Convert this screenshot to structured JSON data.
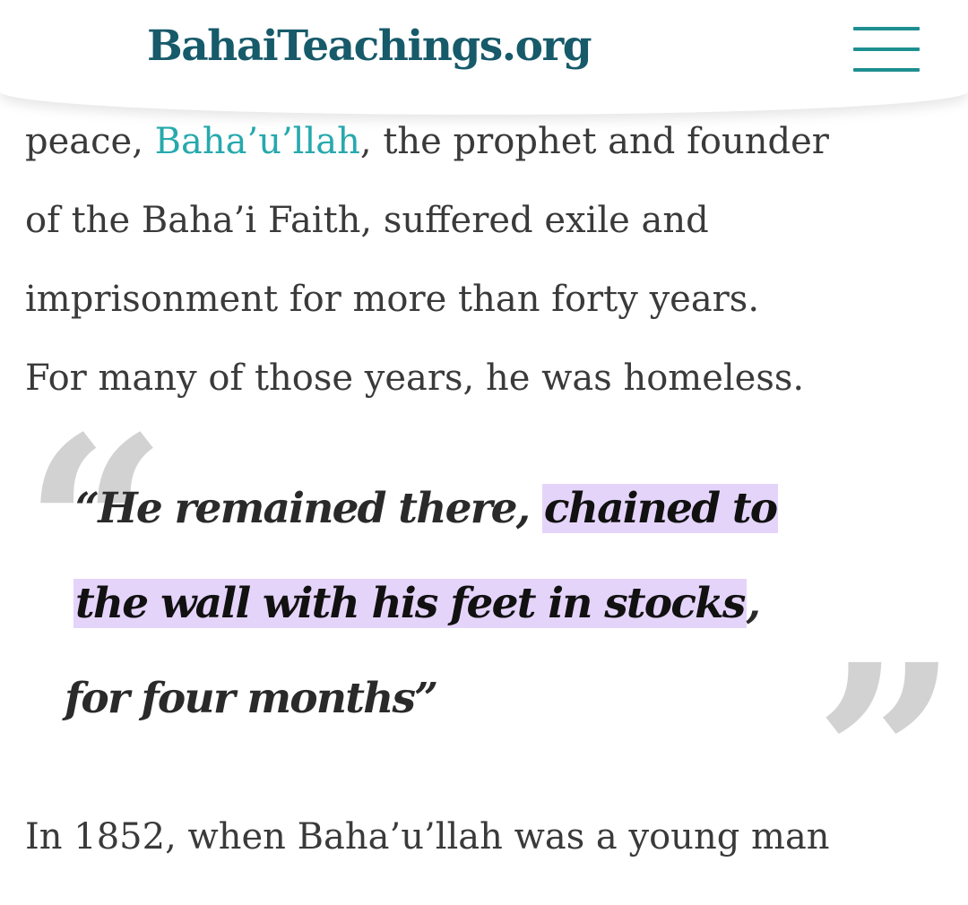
{
  "header": {
    "site_name": "BahaiTeachings.org",
    "menu_icon": "hamburger-menu-icon",
    "logo_icon": "striped-logo-icon",
    "colors": {
      "brand": "#175a6a",
      "accent": "#1e8f91"
    }
  },
  "article": {
    "para1": {
      "line1_pre": "peace, ",
      "line1_link": "Baha’u’llah",
      "line1_post": ", the prophet and founder",
      "line2": "of the Baha’i Faith, suffered exile and",
      "line3": "imprisonment for more than forty years.",
      "line4": "For many of those years, he was homeless."
    },
    "quote": {
      "line1_pre": "“He remained there, ",
      "line1_highlight": "chained to",
      "line2_highlight": "the wall with his feet in stocks",
      "line2_post": ",",
      "line3": "for four months”",
      "open_mark": "“",
      "close_mark": "”",
      "highlight_color": "#e5d4fa"
    },
    "para2": {
      "line1": "In 1852, when Baha’u’llah was a young man"
    },
    "link_color": "#27a9ad"
  }
}
